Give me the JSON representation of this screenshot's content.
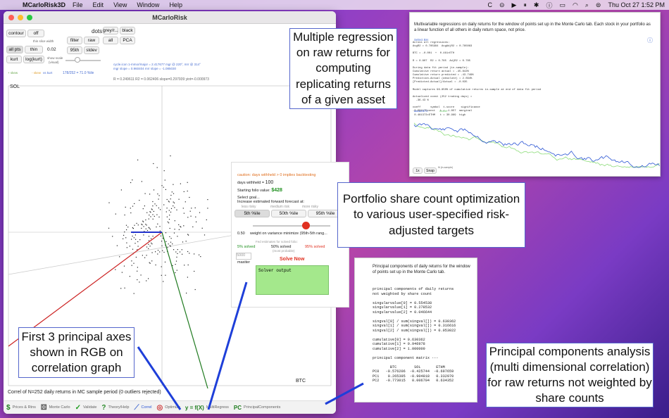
{
  "menubar": {
    "app_name": "MCarloRisk3D",
    "items": [
      "File",
      "Edit",
      "View",
      "Window",
      "Help"
    ],
    "clock": "Thu Oct 27  1:52 PM"
  },
  "window": {
    "title": "MCarloRisk"
  },
  "controls": {
    "contour": "contour",
    "off": "off",
    "thin_slice_width": "thin slice width",
    "all_pts": "all pts",
    "thin": "thin",
    "thin_value": "0.02",
    "kurt": "kurt",
    "logkurt": "log(kurt)",
    "show_scale": "show scale",
    "visual": "(visual)",
    "dots": "dots",
    "grey": "grey/r...",
    "black": "black",
    "all": "all",
    "pca": "PCA",
    "filter": "filter",
    "raw": "raw",
    "p95": "95th",
    "stdev": "stdev",
    "legend_skew": "+ skew",
    "legend_skew2": "- skew",
    "legend_vskurt": "vs kurt",
    "pct_info": "178/252 = 71.0 %ile",
    "cycle_info": "cycle.icon 1-mmor/major = 2.417677 mgr @ 220°, mrr @ 314°",
    "slope_info": "mgr slope = 0.960404  mrr slope = -1.085030",
    "stats_line": "R = 0.249611   R2 = 0.062406  slope=0.297939  yint=-0.000973"
  },
  "plot": {
    "y_label": "SOL",
    "x_label": "BTC",
    "caption": "Correl of N=252 daily returns in MC sample period (0 outliers rejected)"
  },
  "optimize": {
    "caution": "caution:  days withheld > 0 implies backtesting",
    "days_withheld_label": "days withheld = ",
    "days_withheld": "100",
    "starting_value_label": "Starting folio value:",
    "starting_value": "$428",
    "select_goal": "Select goal...",
    "increase_est": "Increase estimated forward forecast at:",
    "less_risky": "less risky",
    "medium_risk": "medium risk",
    "more_risky": "more risky",
    "p5": "5th %ile",
    "p50": "50th %ile",
    "p95b": "95th %ile",
    "weight_value": "0.50",
    "weight_label": "weight on variance minimize (95th-5th rang...",
    "fed_estimates": "Fed estimates for solved folio:",
    "solved5": "5% solved",
    "solved50": "50% solved",
    "solved95": "95% solved",
    "most_probable": "(most probable)",
    "maxiter_value": "5000",
    "maxiter": "maxiter",
    "solve_now": "Solve Now",
    "solver_output": "Solver output"
  },
  "tabs": [
    {
      "icon": "$",
      "label": "Prices & Rtns"
    },
    {
      "icon": "⚄",
      "label": "Monte Carlo"
    },
    {
      "icon": "✓",
      "label": "Validate"
    },
    {
      "icon": "?",
      "label": "Theory/Help"
    },
    {
      "icon": "⟋",
      "label": "Correl"
    },
    {
      "icon": "◎",
      "label": "Optimize"
    },
    {
      "icon": "y = f(X)",
      "label": "MultiRegress"
    },
    {
      "icon": "PC",
      "label": "PrincipalComponents"
    }
  ],
  "annotations": {
    "regression": "Multiple regression on raw returns for computing replicating returns of a given asset",
    "portfolio": "Portfolio share count optimization to various user-specified risk-adjusted targets",
    "principal_axes": "First 3 principal axes shown in RGB on correlation graph",
    "pca": "Principal components analysis (multi dimensional correlation) for raw returns not weighted by share counts"
  },
  "regression_window": {
    "header": "Multivariable regressions on daily returns for the window of points set up in the Monte Carlo tab.  Each stock in your portfolio as a linear function of all others in daily return space, not price.",
    "select_label": "Select BH",
    "body": "Across all regressions:\nAvgR2 = 0.785994  AvgAdjR2 = 0.785083\n\nBTC = -0.001  +  0.461×ETH\n\nR = 0.807  R2 = 0.785  AdjR2 = 0.785\n\nDuring data fit period (in-sample):\nCumulative return actual = -45.842%\nCumulative return predicted = -43.749%\nPrediction-Actual (absolute) = 2.094%\n[Predicted-Actual]/Actual = -0.035\n\nModel captures 96.850% of cumulative returns in-sample at end of data fit period\n\nActualized const (252 trading days) =\n  -36.43 %\n\ncoeff      symbol  t-score    significance\n-0.001175const   t = -1.857  marginal\n 0.461373×ETHM   t = 30.989  high",
    "legend_actual": "actual BTC",
    "legend_model": "model",
    "btn_1x": "1x",
    "btn_snap": "Snap",
    "fit_label": "fit (in-sample)"
  },
  "pc_window": {
    "header": "Principal components of daily returns for the window of points set up in the Monte Carlo tab.",
    "body": "principal components of daily returns\nnot weighted by share count\n\nsingularvalue[0] = 0.554538\nsingularvalue[1] = 0.278532\nsingularvalue[2] = 0.046644\n\nsingval[0] / sum(singval[]) = 0.630362\nsingval[1] / sum(singval[]) = 0.316616\nsingval[2] / sum(singval[]) = 0.053022\n\ncumulative[0] = 0.630362\ncumulative[1] = 0.946978\ncumulative[2] = 1.000000\n\nprincipal component matrix ---\n\n        BTC        SOL       ETHM\nPC0   -0.576206  -0.425744  -0.697659\nPC1    0.265395  -0.904818   0.332970\nPC2   -0.773015   0.006704   0.634352"
  },
  "colors": {
    "pc_red": "#cc2222",
    "pc_green": "#1f7a1f",
    "pc_blue": "#2233cc",
    "solver_bg": "#a4e88c",
    "annot_arrow": "#1e3fd9"
  }
}
